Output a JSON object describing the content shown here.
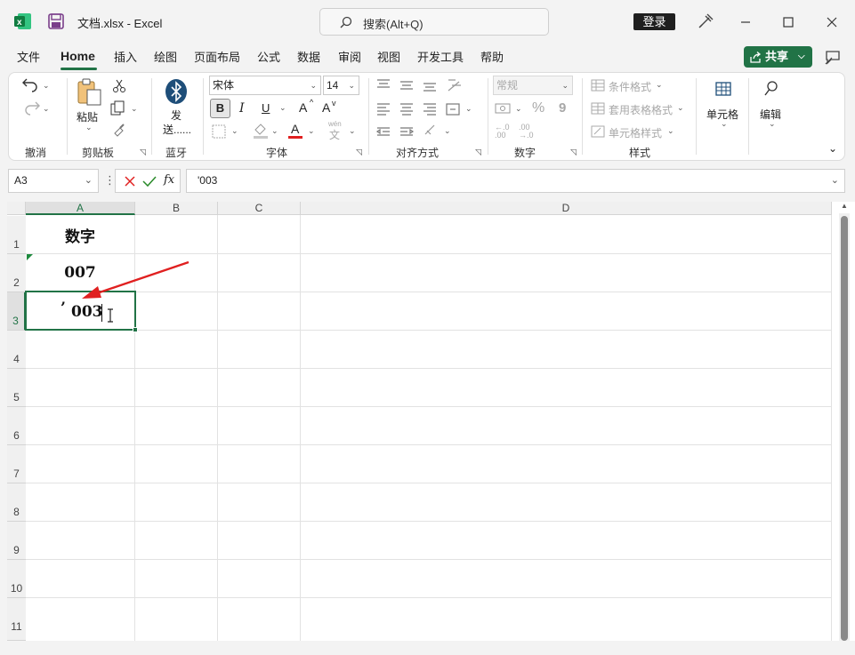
{
  "titlebar": {
    "file_title": "文档.xlsx  -  Excel",
    "search_placeholder": "搜索(Alt+Q)",
    "login_label": "登录"
  },
  "menu": {
    "items": [
      "文件",
      "Home",
      "插入",
      "绘图",
      "页面布局",
      "公式",
      "数据",
      "审阅",
      "视图",
      "开发工具",
      "帮助"
    ],
    "active": "Home",
    "share_label": "共享"
  },
  "ribbon": {
    "undo_group": "撤消",
    "clipboard": {
      "label": "剪贴板",
      "paste": "粘贴"
    },
    "bluetooth": {
      "label": "蓝牙",
      "send1": "发",
      "send2": "送......"
    },
    "font": {
      "label": "字体",
      "name": "宋体",
      "size": "14",
      "bold": "B",
      "italic": "I",
      "underline": "U",
      "grow": "A",
      "shrink": "A",
      "color_a": "A",
      "wen": "wén",
      "wen_char": "文"
    },
    "align": {
      "label": "对齐方式"
    },
    "number": {
      "label": "数字",
      "format": "常规",
      "percent": "%",
      "comma": "9",
      "dec_inc": "←.0\n.00",
      "dec_dec": ".00\n→.0"
    },
    "styles": {
      "label": "样式",
      "conditional": "条件格式",
      "table": "套用表格格式",
      "cell": "单元格样式"
    },
    "cells": {
      "label": "单元格"
    },
    "editing": {
      "label": "编辑"
    }
  },
  "formula_bar": {
    "name_box": "A3",
    "fx": "fx",
    "content": "'003"
  },
  "sheet": {
    "columns": [
      "A",
      "B",
      "C",
      "D"
    ],
    "rows": [
      "1",
      "2",
      "3",
      "4",
      "5",
      "6",
      "7",
      "8",
      "9",
      "10",
      "11"
    ],
    "cells": {
      "A1": "数字",
      "A2": "007",
      "A3_apostrophe": "’",
      "A3_value": "003"
    }
  },
  "colors": {
    "accent": "#217346",
    "arrow": "#e02020",
    "selection": "#217346"
  }
}
